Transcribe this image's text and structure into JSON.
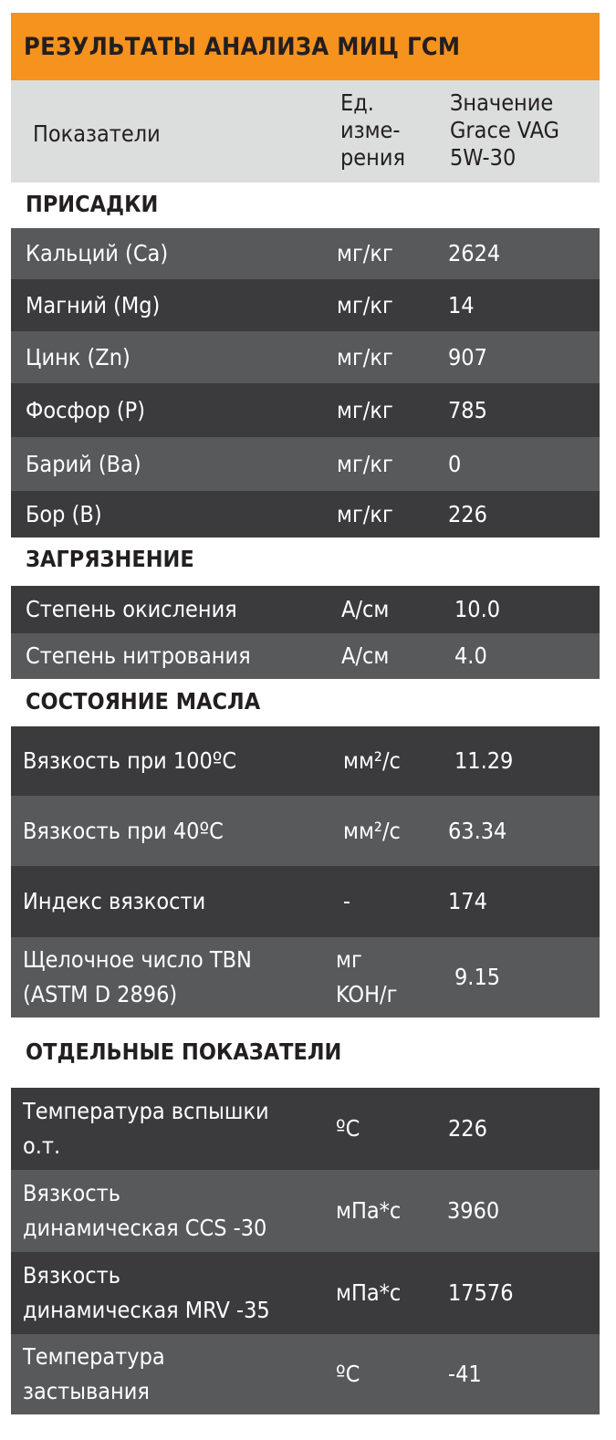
{
  "title": "РЕЗУЛЬТАТЫ АНАЛИЗА МИЦ ГСМ",
  "header": {
    "indicator": "Показатели",
    "unit": "Ед.\nизме-\nрения",
    "value": "Значение\nGrace VAG\n5W-30"
  },
  "sections": [
    {
      "title": "ПРИСАДКИ",
      "rows": [
        {
          "name": "Кальций (Ca)",
          "unit": "мг/кг",
          "value": "2624"
        },
        {
          "name": "Магний (Mg)",
          "unit": "мг/кг",
          "value": "14"
        },
        {
          "name": "Цинк (Zn)",
          "unit": "мг/кг",
          "value": "907"
        },
        {
          "name": "Фосфор (P)",
          "unit": "мг/кг",
          "value": "785"
        },
        {
          "name": "Барий (Ba)",
          "unit": "мг/кг",
          "value": "0"
        },
        {
          "name": "Бор (B)",
          "unit": "мг/кг",
          "value": "226"
        }
      ]
    },
    {
      "title": "ЗАГРЯЗНЕНИЕ",
      "rows": [
        {
          "name": "Степень окисления",
          "unit": "A/см",
          "value": "10.0"
        },
        {
          "name": "Степень нитрования",
          "unit": "A/см",
          "value": "4.0"
        }
      ]
    },
    {
      "title": "СОСТОЯНИЕ МАСЛА",
      "rows": [
        {
          "name": "Вязкость при 100ºС",
          "unit": "мм²/с",
          "value": "11.29"
        },
        {
          "name": "Вязкость при 40ºС",
          "unit": "мм²/с",
          "value": "63.34"
        },
        {
          "name": "Индекс вязкости",
          "unit": "-",
          "value": "174"
        },
        {
          "name": "Щелочное число TBN\n(ASTM D 2896)",
          "unit": "мг\nKOH/г",
          "value": "9.15"
        }
      ]
    },
    {
      "title": "ОТДЕЛЬНЫЕ ПОКАЗАТЕЛИ",
      "rows": [
        {
          "name": "Температура вспышки\nо.т.",
          "unit": "ºС",
          "value": "226"
        },
        {
          "name": "Вязкость\nдинамическая CCS -30",
          "unit": "мПа*с",
          "value": "3960"
        },
        {
          "name": "Вязкость\nдинамическая MRV -35",
          "unit": "мПа*с",
          "value": "17576"
        },
        {
          "name": "Температура\nзастывания",
          "unit": "ºС",
          "value": "-41"
        }
      ]
    }
  ]
}
